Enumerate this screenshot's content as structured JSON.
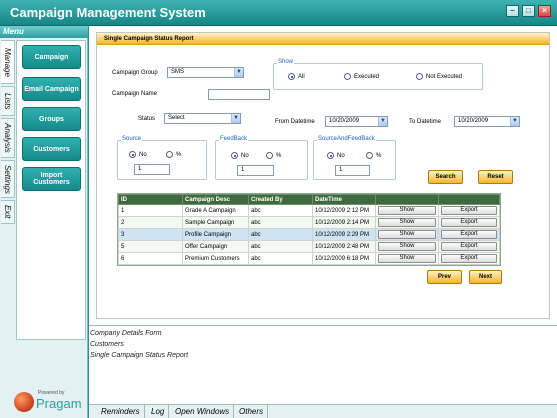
{
  "app": {
    "title": "Campaign Management System"
  },
  "menu": {
    "header": "Menu",
    "vertical_tabs": [
      "Manage",
      "Lists",
      "Analysis",
      "Settings",
      "Exit"
    ],
    "buttons": [
      "Campaign",
      "Email Campaign",
      "Groups",
      "Customers",
      "Import Customers"
    ]
  },
  "logo": {
    "powered": "Powered by",
    "brand": "Pragam"
  },
  "form": {
    "title": "Single Campaign Status Report",
    "campaign_group_label": "Campaign Group",
    "campaign_group_value": "SMS",
    "campaign_name_label": "Campaign Name",
    "campaign_name_value": "",
    "status_label": "Status",
    "status_value": "Select",
    "show": {
      "title": "Show",
      "options": [
        "All",
        "Executed",
        "Not Executed"
      ],
      "selected": "All"
    },
    "from_label": "From Datetime",
    "from_value": "10/20/2009",
    "to_label": "To Datetime",
    "to_value": "10/20/2009",
    "source": {
      "title": "Source",
      "no": "No",
      "pct": "%",
      "value": "1"
    },
    "feedback": {
      "title": "FeedBack",
      "no": "No",
      "pct": "%",
      "value": "1"
    },
    "source_feedback": {
      "title": "SourceAndFeedBack",
      "no": "No",
      "pct": "%",
      "value": "1"
    },
    "search_label": "Search",
    "reset_label": "Reset",
    "prev_label": "Prev",
    "next_label": "Next"
  },
  "grid": {
    "columns": [
      "ID",
      "Campaign Desc",
      "Created By",
      "DateTime",
      "",
      ""
    ],
    "rows": [
      {
        "id": "1",
        "desc": "Grade A Campaign",
        "by": "abc",
        "dt": "10/12/2009 2:12 PM",
        "show": "Show",
        "export": "Export"
      },
      {
        "id": "2",
        "desc": "Sample Campaign",
        "by": "abc",
        "dt": "10/12/2009 2:14 PM",
        "show": "Show",
        "export": "Export"
      },
      {
        "id": "3",
        "desc": "Profile Campaign",
        "by": "abc",
        "dt": "10/12/2009 2:29 PM",
        "show": "Show",
        "export": "Export"
      },
      {
        "id": "5",
        "desc": "Offer  Campaign",
        "by": "abc",
        "dt": "10/12/2009 2:48 PM",
        "show": "Show",
        "export": "Export"
      },
      {
        "id": "6",
        "desc": "Premium Customers",
        "by": "abc",
        "dt": "10/12/2009 6:18 PM",
        "show": "Show",
        "export": "Export"
      }
    ],
    "selected_row_index": 2
  },
  "log": [
    "Company Details Form",
    "Customers",
    "Single Campaign Status Report"
  ],
  "bottom_tabs": [
    "Reminders",
    "Log",
    "Open Windows",
    "Others"
  ],
  "colors": {
    "teal": "#178585",
    "accent": "#f7b52a",
    "grid_header": "#3f6a3f"
  }
}
